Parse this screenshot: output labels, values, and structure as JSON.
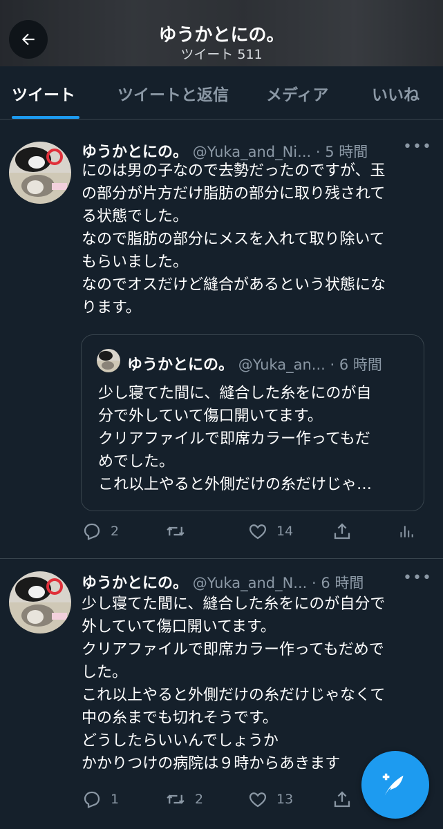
{
  "header": {
    "title": "ゆうかとにの。",
    "subtitle": "ツイート 511"
  },
  "tabs": [
    {
      "label": "ツイート",
      "active": true
    },
    {
      "label": "ツイートと返信",
      "active": false
    },
    {
      "label": "メディア",
      "active": false
    },
    {
      "label": "いいね",
      "active": false
    }
  ],
  "tweets": [
    {
      "name": "ゆうかとにの。",
      "handle": "@Yuka_and_Ni...",
      "time": "· 5 時間",
      "lines": [
        "にのは男の子なので去勢だったのですが、玉",
        "の部分が片方だけ脂肪の部分に取り残されて",
        "る状態でした。",
        "なので脂肪の部分にメスを入れて取り除いて",
        "もらいました。",
        "なのでオスだけど縫合があるという状態にな",
        "ります。"
      ],
      "quote": {
        "name": "ゆうかとにの。",
        "handle": "@Yuka_an...",
        "time": "· 6 時間",
        "lines": [
          "少し寝てた間に、縫合した糸をにのが自",
          "分で外していて傷口開いてます。",
          "クリアファイルで即席カラー作ってもだ",
          "めでした。",
          "これ以上やると外側だけの糸だけじゃ…"
        ]
      },
      "replies": "2",
      "retweets": "",
      "likes": "14"
    },
    {
      "name": "ゆうかとにの。",
      "handle": "@Yuka_and_N...",
      "time": "· 6 時間",
      "lines": [
        "少し寝てた間に、縫合した糸をにのが自分で",
        "外していて傷口開いてます。",
        "クリアファイルで即席カラー作ってもだめで",
        "した。",
        "これ以上やると外側だけの糸だけじゃなくて",
        "中の糸までも切れそうです。",
        "どうしたらいいんでしょうか",
        "かかりつけの病院は９時からあきます"
      ],
      "replies": "1",
      "retweets": "2",
      "likes": "13"
    }
  ],
  "colors": {
    "background": "#15202b",
    "accent": "#1d9bf0",
    "muted": "#8b98a5",
    "border": "#38444d"
  }
}
